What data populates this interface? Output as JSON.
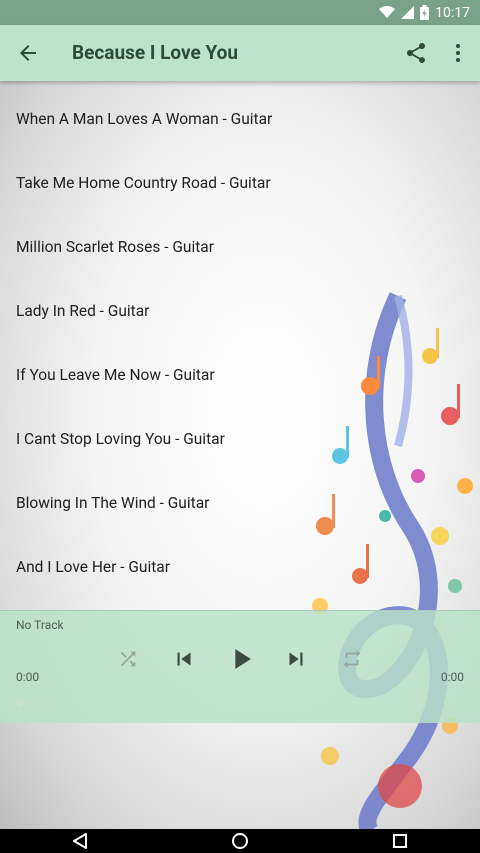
{
  "status_bar": {
    "time": "10:17",
    "icons": [
      "wifi-icon",
      "signal-icon",
      "battery-icon"
    ]
  },
  "app_bar": {
    "title": "Because I Love You",
    "background": "#bce3cc",
    "icons": [
      "back-arrow-icon",
      "share-icon",
      "more-vert-icon"
    ]
  },
  "tracks": [
    {
      "label": "When A Man Loves A Woman - Guitar"
    },
    {
      "label": "Take Me Home Country Road - Guitar"
    },
    {
      "label": "Million Scarlet Roses - Guitar"
    },
    {
      "label": "Lady In Red - Guitar"
    },
    {
      "label": "If You Leave Me Now - Guitar"
    },
    {
      "label": "I Cant Stop Loving You - Guitar"
    },
    {
      "label": "Blowing In The Wind - Guitar"
    },
    {
      "label": "And I Love Her - Guitar"
    }
  ],
  "player": {
    "now_playing": "No Track",
    "elapsed": "0:00",
    "duration": "0:00",
    "progress": 0,
    "icons": [
      "shuffle-icon",
      "skip-previous-icon",
      "play-icon",
      "skip-next-icon",
      "repeat-icon"
    ]
  },
  "nav_bar": {
    "icons": [
      "back-nav-icon",
      "home-nav-icon",
      "recents-nav-icon"
    ]
  }
}
